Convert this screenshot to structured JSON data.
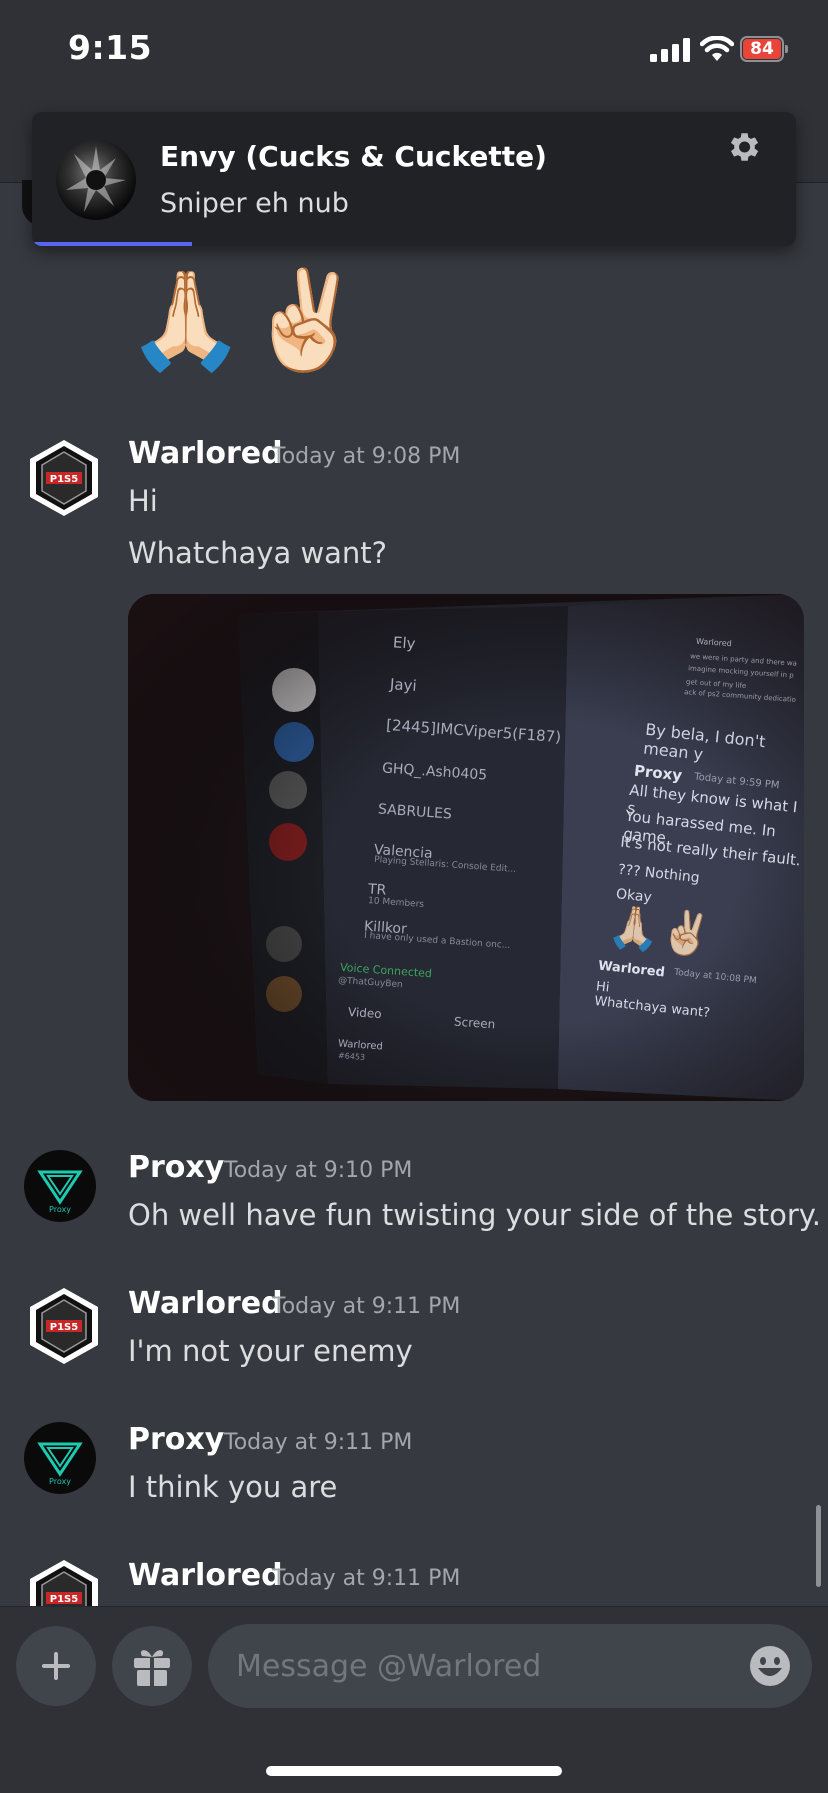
{
  "status_bar": {
    "time": "9:15",
    "battery": "84"
  },
  "notification": {
    "title": "Envy (Cucks & Cuckette)",
    "body": "Sniper eh nub",
    "icon": "gear-icon",
    "accent": "#5865f2"
  },
  "top_message": {
    "emojis": "🙏🏻✌🏻"
  },
  "messages": [
    {
      "author": "Warlored",
      "time": "Today at 9:08 PM",
      "lines": [
        "Hi",
        "Whatchaya want?"
      ],
      "avatar": "warlored-avatar"
    },
    {
      "author": "Proxy",
      "time": "Today at 9:10 PM",
      "lines": [
        "Oh well have fun twisting your side of the story."
      ],
      "avatar": "proxy-avatar"
    },
    {
      "author": "Warlored",
      "time": "Today at 9:11 PM",
      "lines": [
        "I'm not your enemy"
      ],
      "avatar": "warlored-avatar"
    },
    {
      "author": "Proxy",
      "time": "Today at 9:11 PM",
      "lines": [
        "I think you are"
      ],
      "avatar": "proxy-avatar"
    },
    {
      "author": "Warlored",
      "time": "Today at 9:11 PM",
      "lines": [],
      "avatar": "warlored-avatar"
    }
  ],
  "attachment": {
    "channel_list": [
      "Ely",
      "Jayi",
      "[2445]IMCViper5(F187)",
      "GHQ_.Ash0405",
      "SABRULES",
      "Valencia",
      "Playing Stellaris: Console Edit...",
      "TR",
      "10 Members",
      "Killkor",
      "I have only used a Bastion onc..."
    ],
    "voice_status": "Voice Connected",
    "voice_user": "@ThatGuyBen",
    "video_label": "Video",
    "screen_label": "Screen",
    "panel_user": "Warlored",
    "panel_tag": "#6453",
    "chat_header": "By bela, I don't mean y",
    "chat_author": "Proxy",
    "chat_time": "Today at 9:59 PM",
    "chat_lines": [
      "All they know is what I s",
      "You harassed me. In game",
      "It's not really their fault.",
      "??? Nothing",
      "Okay"
    ],
    "chat_author2": "Warlored",
    "chat_time2": "Today at 10:08 PM",
    "chat_lines2": [
      "Hi",
      "Whatchaya want?"
    ],
    "top_right_author": "Warlored",
    "top_right_lines": [
      "we were in party and there wa",
      "imagine mocking yourself in p",
      "get out of my life",
      "ack of ps2 community dedicatio"
    ]
  },
  "composer": {
    "placeholder": "Message @Warlored"
  }
}
